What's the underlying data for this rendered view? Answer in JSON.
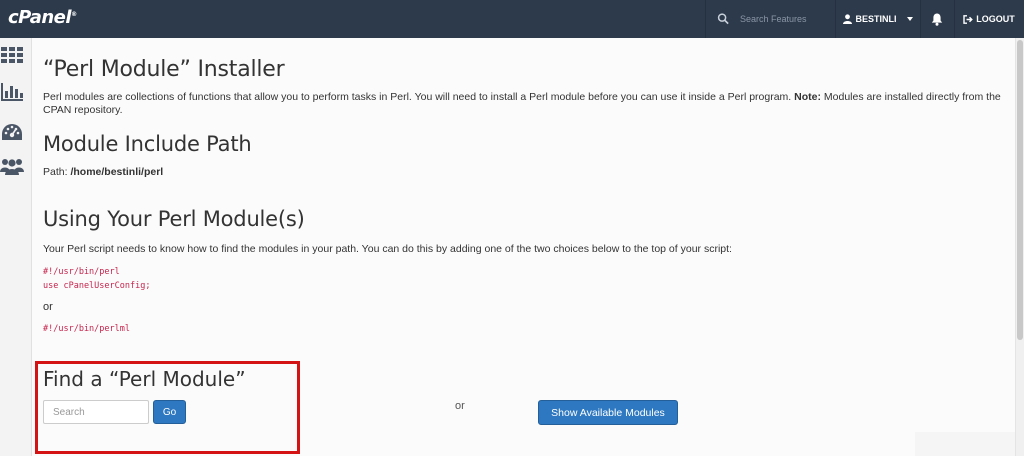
{
  "header": {
    "logo_text": "cPanel",
    "logo_mark": "®",
    "search_placeholder": "Search Features",
    "username": "BESTINLI",
    "logout_label": "LOGOUT",
    "bar_color": "#2d3a4b"
  },
  "sidebar": {
    "items": [
      {
        "icon": "grid-icon"
      },
      {
        "icon": "bar-chart-icon"
      },
      {
        "icon": "dashboard-gauge-icon"
      },
      {
        "icon": "users-icon"
      }
    ]
  },
  "main": {
    "title": "“Perl Module” Installer",
    "intro_text": "Perl modules are collections of functions that allow you to perform tasks in Perl. You will need to install a Perl module before you can use it inside a Perl program.",
    "intro_note_label": "Note:",
    "intro_note_text": "Modules are installed directly from the CPAN repository.",
    "include_heading": "Module Include Path",
    "path_label": "Path:",
    "path_value": "/home/bestinli/perl",
    "using_heading": "Using Your Perl Module(s)",
    "using_text": "Your Perl script needs to know how to find the modules in your path. You can do this by adding one of the two choices below to the top of your script:",
    "code_line1": "#!/usr/bin/perl",
    "code_line2": "use cPanelUserConfig;",
    "or_text": "or",
    "code_line3": "#!/usr/bin/perlml"
  },
  "find": {
    "heading": "Find a “Perl Module”",
    "search_placeholder": "Search",
    "go_label": "Go",
    "or_text": "or",
    "show_label": "Show Available Modules",
    "highlight_color": "#d41414",
    "button_color": "#2d78c0"
  }
}
